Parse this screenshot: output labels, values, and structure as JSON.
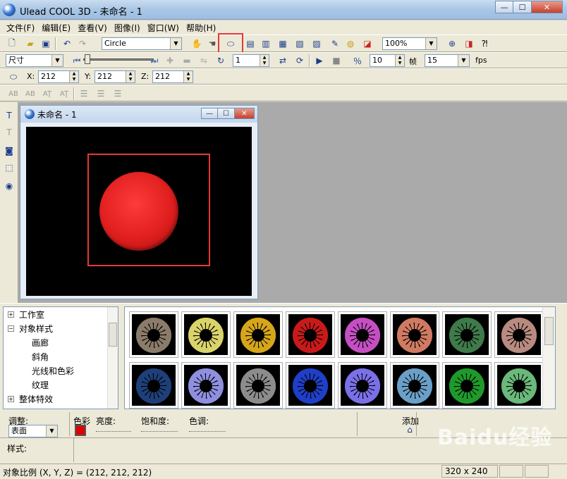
{
  "window": {
    "title": "Ulead COOL 3D - 未命名 - 1",
    "minimize": "—",
    "maximize": "☐",
    "close": "✕"
  },
  "menu": [
    "文件(F)",
    "编辑(E)",
    "查看(V)",
    "图像(I)",
    "窗口(W)",
    "帮助(H)"
  ],
  "toolbar1": {
    "object_select": "Circle",
    "zoom": "100%"
  },
  "toolbar2": {
    "mode_select": "尺寸",
    "frame_value": "1",
    "total_frames": "10",
    "frame_label": "帧",
    "fps_value": "15",
    "fps_label": "fps"
  },
  "toolbar3": {
    "x_label": "X:",
    "x": "212",
    "y_label": "Y:",
    "y": "212",
    "z_label": "Z:",
    "z": "212"
  },
  "toolbar4": {
    "text_tools": [
      "AB",
      "AB",
      "AŢ",
      "AŢ"
    ]
  },
  "document": {
    "title": "未命名 - 1"
  },
  "canvas": {
    "background": "#000000",
    "object_color": "#e31f1f"
  },
  "tree": {
    "items": [
      {
        "label": "工作室",
        "expander": "+"
      },
      {
        "label": "对象样式",
        "expander": "−"
      },
      {
        "label": "画廊"
      },
      {
        "label": "斜角"
      },
      {
        "label": "光线和色彩"
      },
      {
        "label": "纹理"
      },
      {
        "label": "整体特效",
        "expander": "+"
      }
    ]
  },
  "gallery": {
    "colors": [
      "#8a7b6a",
      "#d9d36a",
      "#d6a51a",
      "#c81a1a",
      "#c54fc2",
      "#d07a62",
      "#3f7a4a",
      "#b88a80",
      "#1f3f7a",
      "#8f8fe0",
      "#8c8c8c",
      "#1f3fc8",
      "#7a70e8",
      "#6a9fc8",
      "#1f9a2a",
      "#6ab87a"
    ]
  },
  "adjust": {
    "adjust_label": "调整:",
    "surface_select": "表面",
    "color_label": "色彩",
    "color_value": "#e00000",
    "brightness_label": "亮度:",
    "saturation_label": "饱和度:",
    "hue_label": "色调:",
    "add_label": "添加"
  },
  "style": {
    "label": "样式:"
  },
  "status": {
    "text": "对象比例 (X, Y, Z) = (212, 212, 212)",
    "resolution": "320 x 240"
  },
  "watermark": "Baidu经验"
}
